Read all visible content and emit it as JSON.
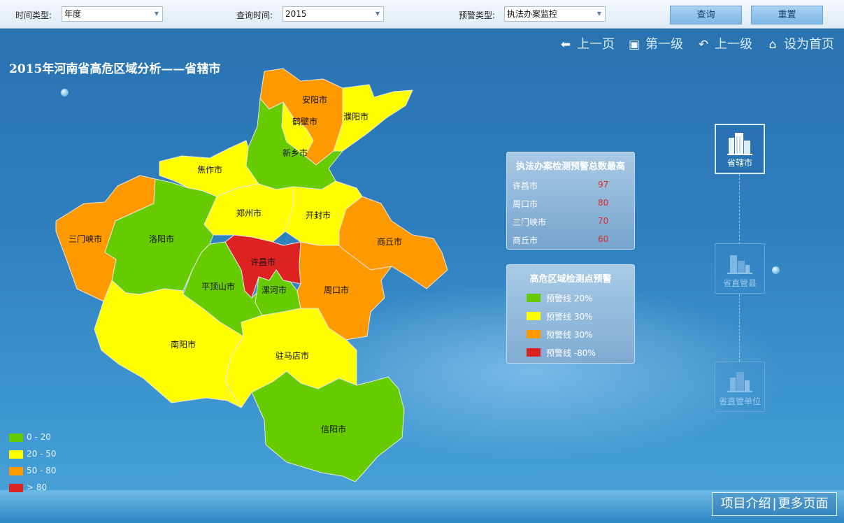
{
  "filters": {
    "time_type_label": "时间类型:",
    "time_type_value": "年度",
    "query_time_label": "查询时间:",
    "query_time_value": "2015",
    "warning_type_label": "预警类型:",
    "warning_type_value": "执法办案监控",
    "query_button": "查询",
    "reset_button": "重置"
  },
  "nav": {
    "prev_page": "上一页",
    "first_level": "第一级",
    "up_level": "上一级",
    "set_home": "设为首页"
  },
  "title": "2015年河南省高危区域分析——省辖市",
  "regions": {
    "anyang": "安阳市",
    "puyang": "濮阳市",
    "hebi": "鹤壁市",
    "xinxiang": "新乡市",
    "jiaozuo": "焦作市",
    "zhengzhou": "郑州市",
    "kaifeng": "开封市",
    "sanmenxia": "三门峡市",
    "luoyang": "洛阳市",
    "shangqiu": "商丘市",
    "xuchang": "许昌市",
    "pingdingshan": "平顶山市",
    "luohe": "漯河市",
    "zhoukou": "周口市",
    "nanyang": "南阳市",
    "zhumadian": "驻马店市",
    "xinyang": "信阳市"
  },
  "top_box": {
    "title": "执法办案检测预警总数最高",
    "rows": [
      {
        "name": "许昌市",
        "value": "97"
      },
      {
        "name": "周口市",
        "value": "80"
      },
      {
        "name": "三门峡市",
        "value": "70"
      },
      {
        "name": "商丘市",
        "value": "60"
      }
    ]
  },
  "warning_box": {
    "title": "高危区域检测点预警",
    "lines": [
      {
        "label": "预警线 20%",
        "color": "#66cc00"
      },
      {
        "label": "预警线 30%",
        "color": "#ffff00"
      },
      {
        "label": "预警线 30%",
        "color": "#ff9900"
      },
      {
        "label": "预警线 -80%",
        "color": "#dd2222"
      }
    ]
  },
  "levels": {
    "provincial_city": "省辖市",
    "provincial_county": "省直管县",
    "provincial_unit": "省直管单位"
  },
  "legend": [
    {
      "label": "0 - 20",
      "color": "#66cc00"
    },
    {
      "label": "20 - 50",
      "color": "#ffff00"
    },
    {
      "label": "50 - 80",
      "color": "#ff9900"
    },
    {
      "label": "> 80",
      "color": "#dd2222"
    }
  ],
  "footer": {
    "intro": "项目介绍",
    "sep": "|",
    "more": "更多页面"
  },
  "colors": {
    "green": "#66cc00",
    "yellow": "#ffff00",
    "orange": "#ff9900",
    "red": "#dd2222"
  }
}
